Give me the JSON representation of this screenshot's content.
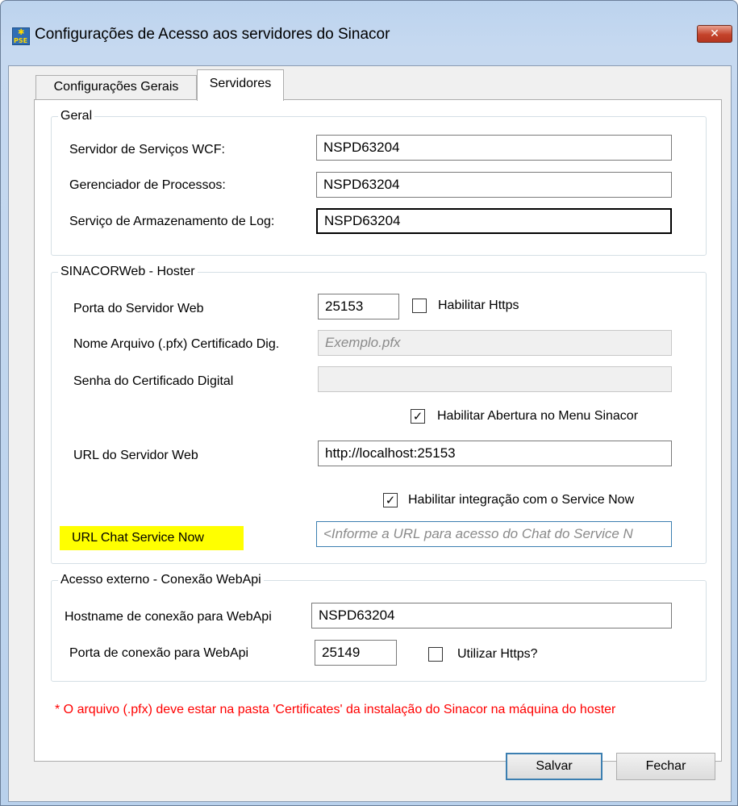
{
  "window": {
    "title": "Configurações de Acesso aos servidores do Sinacor",
    "icon_text": "PSE",
    "close_glyph": "✕"
  },
  "tabs": [
    {
      "label": "Configurações Gerais",
      "active": false
    },
    {
      "label": "Servidores",
      "active": true
    }
  ],
  "geral": {
    "legend": "Geral",
    "wcf_label": "Servidor de Serviços WCF:",
    "wcf_value": "NSPD63204",
    "processos_label": "Gerenciador de Processos:",
    "processos_value": "NSPD63204",
    "log_label": "Serviço de Armazenamento de Log:",
    "log_value": "NSPD63204"
  },
  "hoster": {
    "legend": "SINACORWeb - Hoster",
    "porta_label": "Porta do Servidor Web",
    "porta_value": "25153",
    "https_label": "Habilitar Https",
    "https_checked": false,
    "pfx_label": "Nome Arquivo (.pfx) Certificado Dig.",
    "pfx_placeholder": "Exemplo.pfx",
    "senha_label": "Senha do Certificado Digital",
    "senha_value": "",
    "menu_label": "Habilitar Abertura no Menu Sinacor",
    "menu_checked": true,
    "url_label": "URL do Servidor Web",
    "url_value": "http://localhost:25153",
    "servicenow_label": "Habilitar integração com o Service Now",
    "servicenow_checked": true,
    "chat_label": "URL Chat Service Now",
    "chat_placeholder": "<Informe a URL para acesso do Chat do Service N"
  },
  "webapi": {
    "legend": "Acesso externo - Conexão WebApi",
    "hostname_label": "Hostname de conexão para WebApi",
    "hostname_value": "NSPD63204",
    "porta_label": "Porta de conexão para WebApi",
    "porta_value": "25149",
    "https_label": "Utilizar Https?",
    "https_checked": false
  },
  "note": "* O arquivo (.pfx) deve estar na pasta 'Certificates' da instalação do Sinacor na máquina do hoster",
  "buttons": {
    "save": "Salvar",
    "close": "Fechar"
  },
  "check_glyph": "✓",
  "colors": {
    "highlight": "#ffff00",
    "note": "#ff0000",
    "focus_border": "#3c7fb1"
  }
}
